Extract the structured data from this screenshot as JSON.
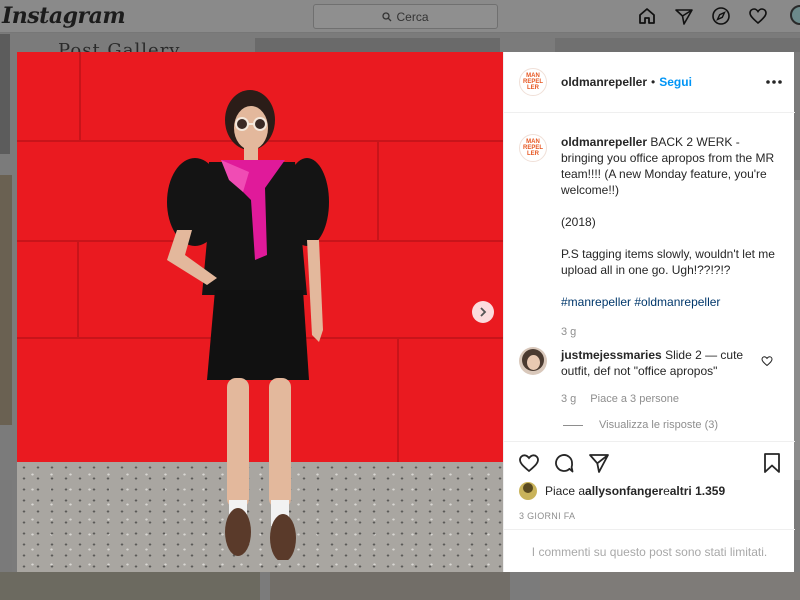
{
  "topbar": {
    "logo": "Instagram",
    "search_placeholder": "Cerca",
    "icons": [
      "home-icon",
      "direct-icon",
      "explore-icon",
      "activity-heart-icon",
      "profile-avatar"
    ]
  },
  "background": {
    "partial_caption": "Post Gallery"
  },
  "post": {
    "brand_logo_text": [
      "MAN",
      "REPEL",
      "LER"
    ],
    "username": "oldmanrepeller",
    "separator": "•",
    "follow_label": "Segui",
    "caption": {
      "username": "oldmanrepeller",
      "text": " BACK 2 WERK - bringing you office apropos from the MR team!!!! (A new Monday feature, you're welcome!!)",
      "year": "(2018)",
      "note": "P.S tagging items slowly, wouldn't let me upload all in one go. Ugh!??!?!?",
      "hashtags": "#manrepeller #oldmanrepeller",
      "time": "3 g"
    },
    "comment": {
      "username": "justmejessmaries",
      "text": " Slide 2 — cute outfit, def not \"office apropos\"",
      "time": "3 g",
      "likes": "Piace a 3 persone",
      "view_replies": "Visualizza le risposte (3)"
    },
    "likes": {
      "prefix": "Piace a ",
      "user": "allysonfanger",
      "middle": " e ",
      "others": "altri 1.359"
    },
    "date": "3 GIORNI FA",
    "comments_limited": "I commenti su questo post sono stati limitati."
  },
  "colors": {
    "accent": "#0095f6",
    "wall_red": "#ea1a20",
    "brand_orange": "#e65722"
  }
}
